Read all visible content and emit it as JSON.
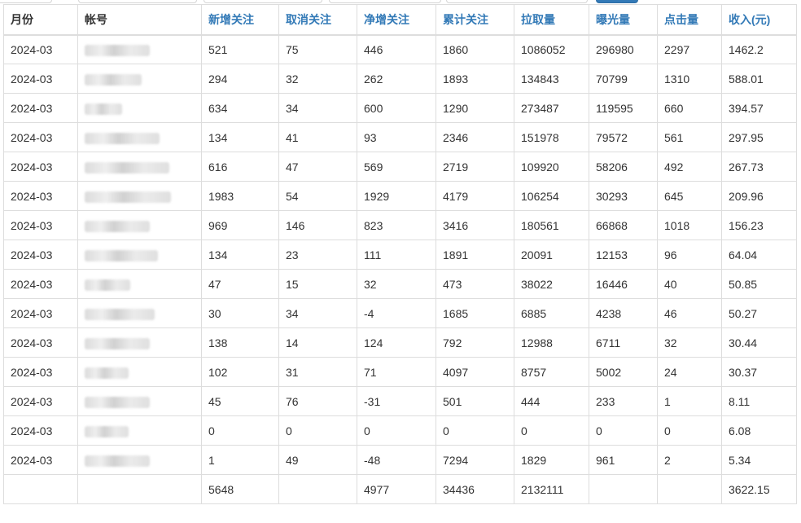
{
  "table": {
    "headers": [
      "月份",
      "帐号",
      "新增关注",
      "取消关注",
      "净增关注",
      "累计关注",
      "拉取量",
      "曝光量",
      "点击量",
      "收入(元)"
    ],
    "rows": [
      [
        "2024-03",
        "",
        "521",
        "75",
        "446",
        "1860",
        "1086052",
        "296980",
        "2297",
        "1462.2"
      ],
      [
        "2024-03",
        "",
        "294",
        "32",
        "262",
        "1893",
        "134843",
        "70799",
        "1310",
        "588.01"
      ],
      [
        "2024-03",
        "",
        "634",
        "34",
        "600",
        "1290",
        "273487",
        "119595",
        "660",
        "394.57"
      ],
      [
        "2024-03",
        "",
        "134",
        "41",
        "93",
        "2346",
        "151978",
        "79572",
        "561",
        "297.95"
      ],
      [
        "2024-03",
        "",
        "616",
        "47",
        "569",
        "2719",
        "109920",
        "58206",
        "492",
        "267.73"
      ],
      [
        "2024-03",
        "",
        "1983",
        "54",
        "1929",
        "4179",
        "106254",
        "30293",
        "645",
        "209.96"
      ],
      [
        "2024-03",
        "",
        "969",
        "146",
        "823",
        "3416",
        "180561",
        "66868",
        "1018",
        "156.23"
      ],
      [
        "2024-03",
        "",
        "134",
        "23",
        "111",
        "1891",
        "20091",
        "12153",
        "96",
        "64.04"
      ],
      [
        "2024-03",
        "",
        "47",
        "15",
        "32",
        "473",
        "38022",
        "16446",
        "40",
        "50.85"
      ],
      [
        "2024-03",
        "",
        "30",
        "34",
        "-4",
        "1685",
        "6885",
        "4238",
        "46",
        "50.27"
      ],
      [
        "2024-03",
        "",
        "138",
        "14",
        "124",
        "792",
        "12988",
        "6711",
        "32",
        "30.44"
      ],
      [
        "2024-03",
        "",
        "102",
        "31",
        "71",
        "4097",
        "8757",
        "5002",
        "24",
        "30.37"
      ],
      [
        "2024-03",
        "",
        "45",
        "76",
        "-31",
        "501",
        "444",
        "233",
        "1",
        "8.11"
      ],
      [
        "2024-03",
        "",
        "0",
        "0",
        "0",
        "0",
        "0",
        "0",
        "0",
        "6.08"
      ],
      [
        "2024-03",
        "",
        "1",
        "49",
        "-48",
        "7294",
        "1829",
        "961",
        "2",
        "5.34"
      ]
    ],
    "totals": [
      "",
      "",
      "5648",
      "",
      "4977",
      "34436",
      "2132111",
      "",
      "",
      "3622.15"
    ]
  },
  "colors": {
    "link": "#337ab7",
    "text": "#333333",
    "border": "#dddddd"
  }
}
